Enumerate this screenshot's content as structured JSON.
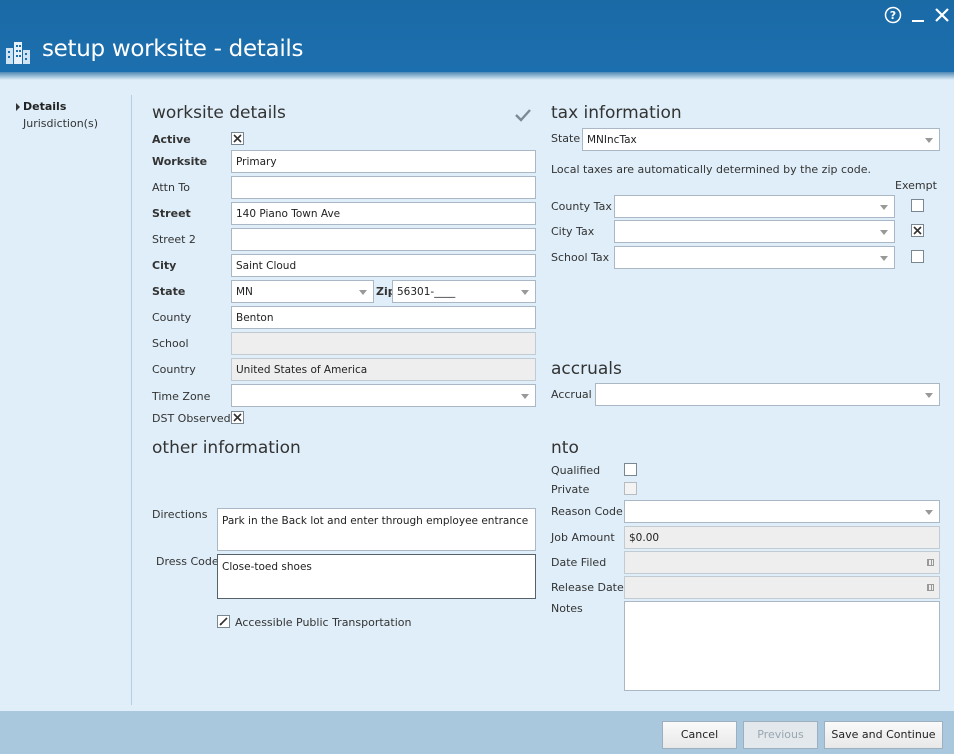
{
  "window": {
    "title": "setup worksite - details",
    "help_icon": "?",
    "minimize_icon": "_",
    "close_icon": "×"
  },
  "nav": {
    "items": [
      {
        "label": "Details",
        "active": true
      },
      {
        "label": "Jurisdiction(s)",
        "active": false
      }
    ]
  },
  "worksite": {
    "heading": "worksite details",
    "active_label": "Active",
    "active_checked": true,
    "worksite_label": "Worksite",
    "worksite_value": "Primary",
    "attn_label": "Attn To",
    "attn_value": "",
    "street_label": "Street",
    "street_value": "140 Piano Town Ave",
    "street2_label": "Street 2",
    "street2_value": "",
    "city_label": "City",
    "city_value": "Saint Cloud",
    "state_label": "State",
    "state_value": "MN",
    "zip_label": "Zip",
    "zip_value": "56301-____",
    "county_label": "County",
    "county_value": "Benton",
    "school_label": "School",
    "school_value": "",
    "country_label": "Country",
    "country_value": "United States of America",
    "timezone_label": "Time Zone",
    "timezone_value": "",
    "dst_label": "DST Observed",
    "dst_checked": true
  },
  "tax": {
    "heading": "tax information",
    "state_label": "State",
    "state_value": "MNIncTax",
    "note": "Local taxes are automatically determined by the zip code.",
    "exempt_label": "Exempt",
    "county_label": "County Tax",
    "county_value": "",
    "county_exempt": false,
    "city_label": "City Tax",
    "city_value": "",
    "city_exempt": true,
    "school_label": "School Tax",
    "school_value": "",
    "school_exempt": false
  },
  "accruals": {
    "heading": "accruals",
    "accrual_label": "Accrual",
    "accrual_value": ""
  },
  "other": {
    "heading": "other information",
    "directions_label": "Directions",
    "directions_value": "Park in the Back lot and enter through employee entrance",
    "dress_label": "Dress Code",
    "dress_value": "Close-toed shoes",
    "transport_label": "Accessible Public Transportation",
    "transport_checked": true
  },
  "nto": {
    "heading": "nto",
    "qualified_label": "Qualified",
    "qualified_checked": false,
    "private_label": "Private",
    "private_checked": false,
    "reason_label": "Reason Code",
    "reason_value": "",
    "job_amount_label": "Job Amount",
    "job_amount_value": "$0.00",
    "date_filed_label": "Date Filed",
    "date_filed_value": "",
    "release_label": "Release Date",
    "release_value": "",
    "notes_label": "Notes",
    "notes_value": ""
  },
  "footer": {
    "cancel_label": "Cancel",
    "previous_label": "Previous",
    "save_label": "Save and Continue"
  },
  "colors": {
    "titlebar": "#1c6fae",
    "background": "#dfeef8",
    "footer": "#a9c8de"
  }
}
